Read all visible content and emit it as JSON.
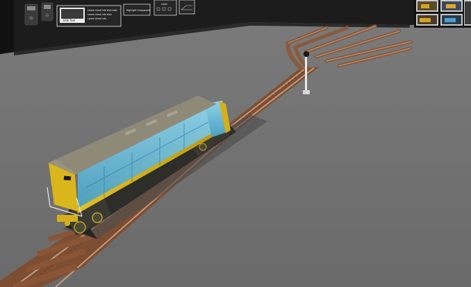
{
  "wall": {
    "panel_card": {
      "title": "EDE Tool",
      "lines": [
        "Lorem shred info blah blah",
        "Lorem shred info blah",
        "Lorem shred info"
      ]
    },
    "panel_button": {
      "label": "Highlight Component"
    },
    "panel_controls": {
      "label": "Layer"
    }
  },
  "thumbnails": [
    "thumb-1",
    "thumb-2",
    "thumb-3",
    "thumb-4",
    "thumb-5"
  ],
  "colors": {
    "floor": "#6f6f6f",
    "wall": "#1a1a1a",
    "rail_ballast": "#8a5a3c",
    "rail_steel": "#b8927a",
    "loco_yellow": "#d4b01a",
    "loco_body_cutaway": "#7fc2dc",
    "loco_roof": "#8f8a78"
  }
}
